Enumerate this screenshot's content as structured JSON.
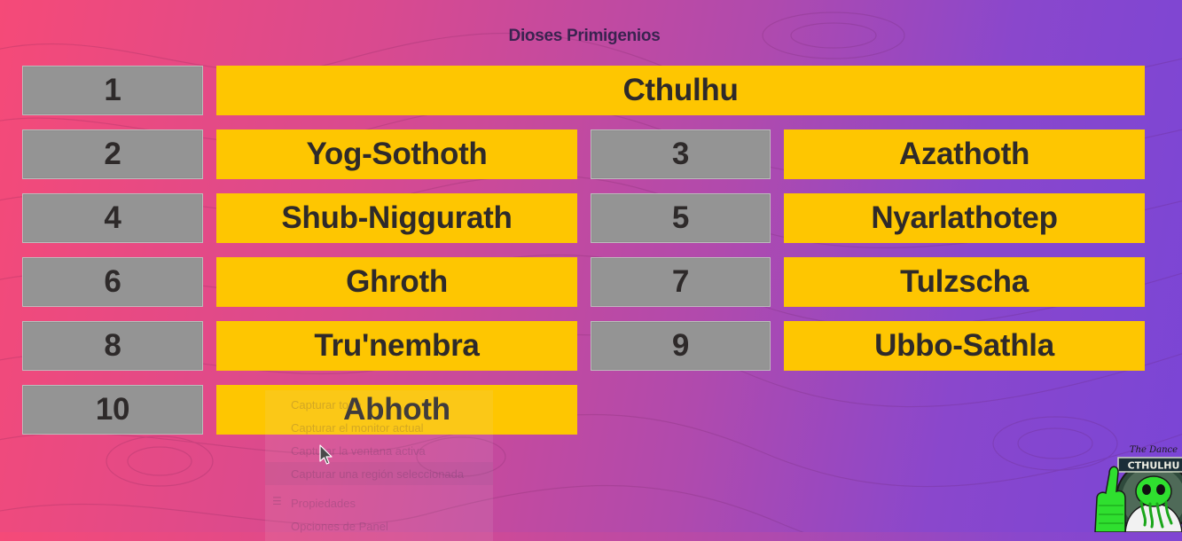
{
  "title": "Dioses Primigenios",
  "rows": [
    {
      "num": "1",
      "name": "Cthulhu"
    },
    {
      "num": "2",
      "name": "Yog-Sothoth"
    },
    {
      "num": "3",
      "name": "Azathoth"
    },
    {
      "num": "4",
      "name": "Shub-Niggurath"
    },
    {
      "num": "5",
      "name": "Nyarlathotep"
    },
    {
      "num": "6",
      "name": "Ghroth"
    },
    {
      "num": "7",
      "name": "Tulzscha"
    },
    {
      "num": "8",
      "name": "Tru'nembra"
    },
    {
      "num": "9",
      "name": "Ubbo-Sathla"
    },
    {
      "num": "10",
      "name": "Abhoth"
    }
  ],
  "context_menu": {
    "items": [
      "Capturar todo",
      "Capturar el monitor actual",
      "Capturar la ventana activa",
      "Capturar una región seleccionada",
      "Propiedades",
      "Opciones de Panel"
    ]
  },
  "logo": {
    "top_text": "The Dance",
    "band_text": "CTHULHU"
  },
  "colors": {
    "number_cell": "#949494",
    "name_cell": "#fec601",
    "text": "#2e2a2a",
    "gradient_left": "#f54a78",
    "gradient_right": "#7a45d6"
  }
}
